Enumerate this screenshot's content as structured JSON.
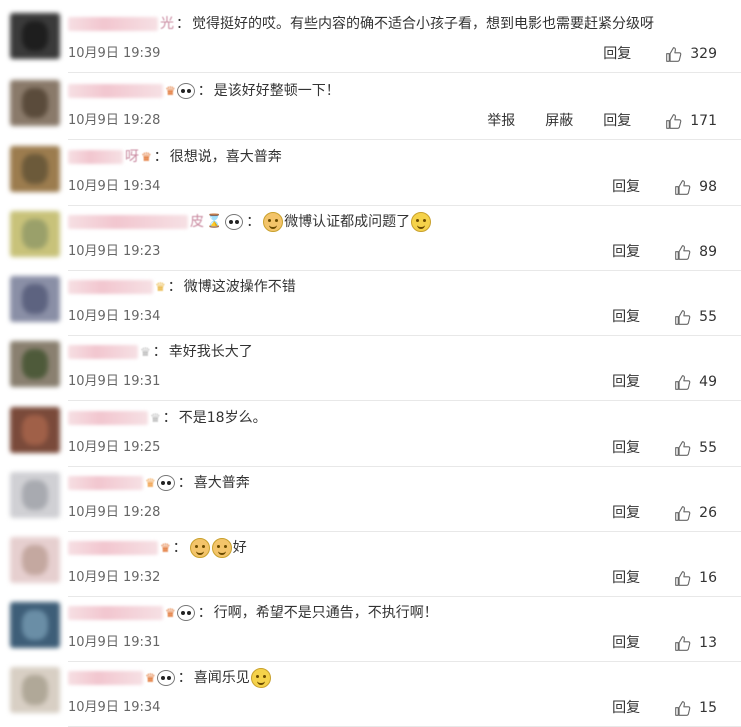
{
  "ui": {
    "reply_label": "回复",
    "report_label": "举报",
    "block_label": "屏蔽",
    "colon": "："
  },
  "colors": {
    "separator": "#e8e8e8",
    "username_blur": "#f2c6cf",
    "text": "#333333",
    "meta": "#666666"
  },
  "comments": [
    {
      "name_tail": "光",
      "badges": [],
      "content": "觉得挺好的哎。有些内容的确不适合小孩子看，想到电影也需要赶紧分级呀",
      "date": "10月9日 19:39",
      "likes": "329",
      "avatar": [
        "#3a3a3a",
        "#1e1e1e"
      ]
    },
    {
      "name_tail": "",
      "badges": [
        "crown-badge",
        "panda"
      ],
      "content": "是该好好整顿一下！",
      "date": "10月9日 19:28",
      "likes": "171",
      "show_report": true,
      "avatar": [
        "#8a7a6a",
        "#5a4b3b"
      ]
    },
    {
      "name_tail": "呀",
      "badges": [
        "crown-badge"
      ],
      "content": "很想说，喜大普奔",
      "date": "10月9日 19:34",
      "likes": "98",
      "avatar": [
        "#9c7c4e",
        "#6c5a3a"
      ]
    },
    {
      "name_tail": "皮",
      "badges": [
        "hourglass",
        "panda"
      ],
      "content_prefix_emoji": "doge",
      "content": "微博认证都成问题了",
      "content_suffix_emoji": "laugh",
      "date": "10月9日 19:23",
      "likes": "89",
      "avatar": [
        "#c8c27a",
        "#9aa06a"
      ]
    },
    {
      "name_tail": "",
      "badges": [
        "vip-badge"
      ],
      "content": "微博这波操作不错",
      "date": "10月9日 19:34",
      "likes": "55",
      "avatar": [
        "#8a8fa6",
        "#5d6380"
      ]
    },
    {
      "name_tail": "",
      "badges": [
        "gray-badge"
      ],
      "content": "幸好我长大了",
      "date": "10月9日 19:31",
      "likes": "49",
      "avatar": [
        "#8a8070",
        "#4e5a3a"
      ]
    },
    {
      "name_tail": "",
      "badges": [
        "gray-badge"
      ],
      "content": "不是18岁么。",
      "date": "10月9日 19:25",
      "likes": "55",
      "avatar": [
        "#7a4a3a",
        "#a06048"
      ]
    },
    {
      "name_tail": "",
      "badges": [
        "orange-badge",
        "panda"
      ],
      "content": "喜大普奔",
      "date": "10月9日 19:28",
      "likes": "26",
      "avatar": [
        "#d0d0d4",
        "#a8aab0"
      ]
    },
    {
      "name_tail": "",
      "badges": [
        "crown-badge"
      ],
      "content_prefix_emoji": "doge2",
      "content": "好",
      "date": "10月9日 19:32",
      "likes": "16",
      "avatar": [
        "#e6cfcf",
        "#c4a8a0"
      ]
    },
    {
      "name_tail": "",
      "badges": [
        "crown-badge",
        "panda"
      ],
      "content": "行啊，希望不是只通告，不执行啊！",
      "date": "10月9日 19:31",
      "likes": "13",
      "avatar": [
        "#3e5e78",
        "#6a8ea6"
      ]
    },
    {
      "name_tail": "",
      "badges": [
        "crown-badge",
        "panda"
      ],
      "content": "喜闻乐见",
      "content_suffix_emoji": "laugh",
      "date": "10月9日 19:34",
      "likes": "15",
      "avatar": [
        "#d8cfc4",
        "#b0a898"
      ]
    }
  ]
}
